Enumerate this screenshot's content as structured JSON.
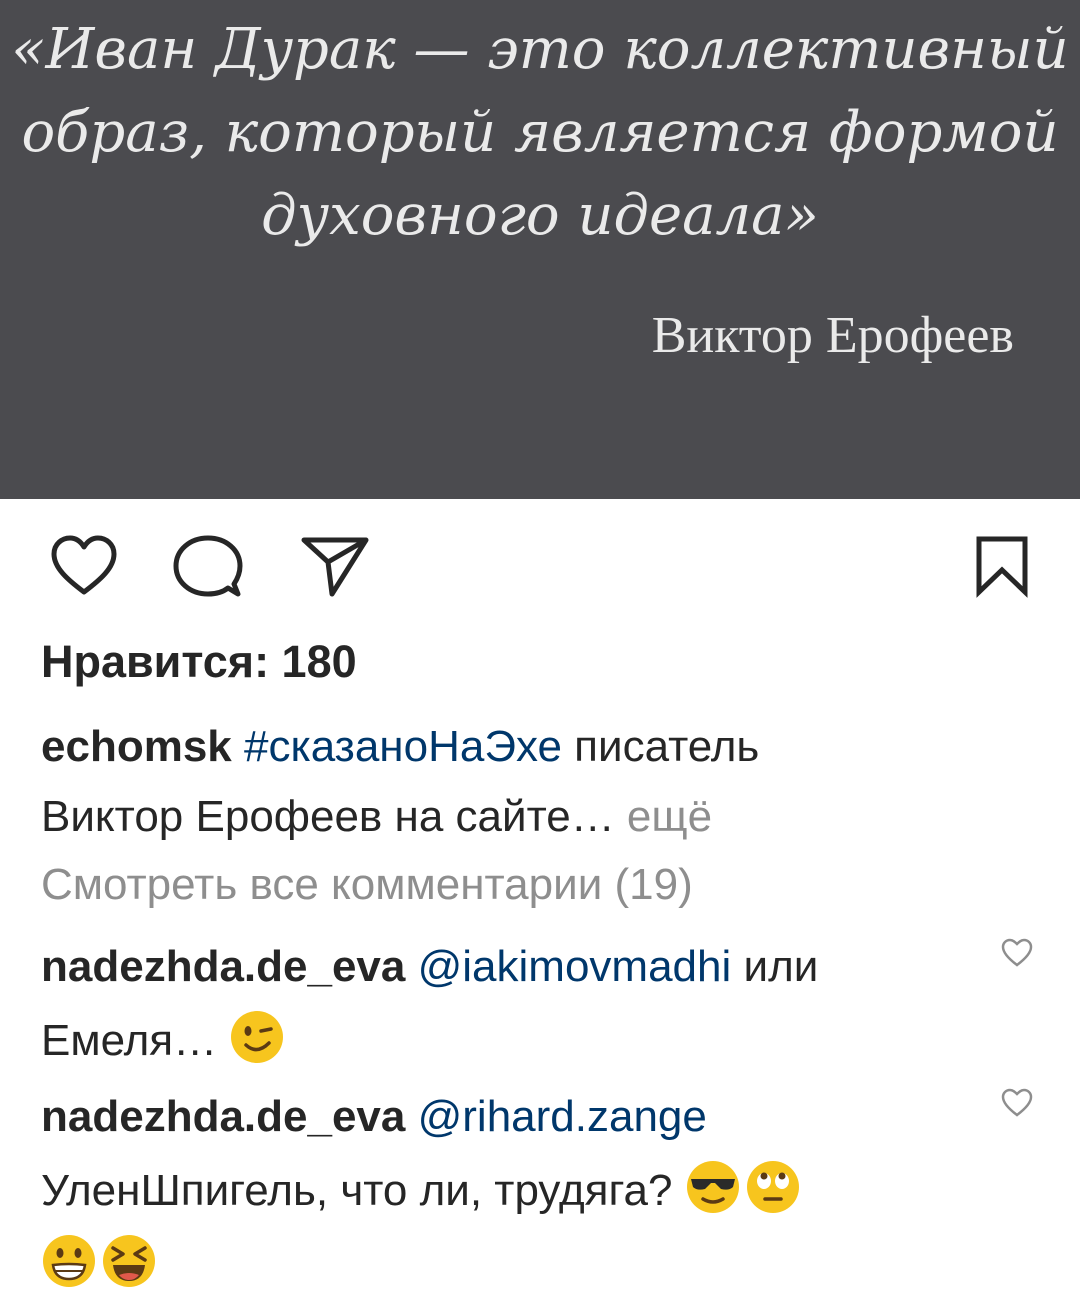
{
  "post": {
    "quote_lines": [
      "«Иван Дурак — это коллективный",
      "образ, который является формой",
      "духовного идеала»"
    ],
    "author": "Виктор Ерофеев"
  },
  "actions": {
    "like_icon": "heart-icon",
    "comment_icon": "comment-icon",
    "share_icon": "send-icon",
    "save_icon": "bookmark-icon"
  },
  "likes_text": "Нравится: 180",
  "caption": {
    "username": "echomsk",
    "hashtag": "#сказаноНаЭхе",
    "text_1": " писатель",
    "text_2": "Виктор Ерофеев на сайте…",
    "more": " ещё"
  },
  "view_all_comments": "Смотреть все комментарии (19)",
  "comments": [
    {
      "username": "nadezhda.de_eva",
      "mention": "@iakimovmadhi",
      "text_1": " или",
      "text_2": "Емеля… ",
      "emojis": [
        "wink"
      ]
    },
    {
      "username": "nadezhda.de_eva",
      "mention": "@rihard.zange",
      "text_1": "УленШпигель, что ли, трудяга? ",
      "emojis_line1": [
        "sunglasses",
        "eye-roll"
      ],
      "emojis_line2": [
        "grin",
        "laughing"
      ]
    }
  ],
  "colors": {
    "image_bg": "#4b4b4f",
    "link": "#00376b",
    "muted": "#8e8e8e",
    "text": "#262626"
  }
}
